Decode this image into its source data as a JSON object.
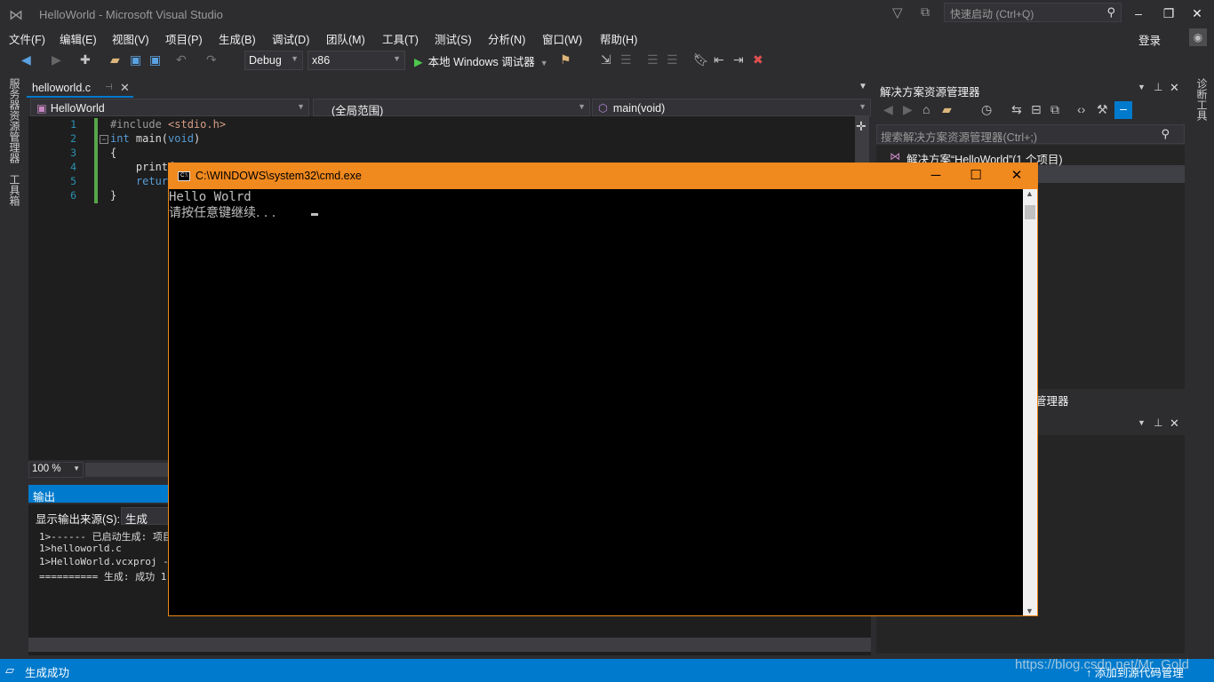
{
  "window": {
    "title": "HelloWorld - Microsoft Visual Studio",
    "quick_launch_placeholder": "快速启动 (Ctrl+Q)",
    "login": "登录"
  },
  "menu": [
    "文件(F)",
    "编辑(E)",
    "视图(V)",
    "项目(P)",
    "生成(B)",
    "调试(D)",
    "团队(M)",
    "工具(T)",
    "测试(S)",
    "分析(N)",
    "窗口(W)",
    "帮助(H)"
  ],
  "toolbar": {
    "config": "Debug",
    "platform": "x86",
    "run_label": "本地 Windows 调试器"
  },
  "left_strip": {
    "server_explorer": "服务器资源管理器",
    "toolbox": "工具箱"
  },
  "editor": {
    "tab_name": "helloworld.c",
    "nav_project": "HelloWorld",
    "nav_scope": "(全局范围)",
    "nav_member": "main(void)",
    "zoom": "100 %",
    "line_numbers": [
      "1",
      "2",
      "3",
      "4",
      "5",
      "6"
    ]
  },
  "output": {
    "title": "输出",
    "source_label": "显示输出来源(S):",
    "source_value": "生成",
    "lines": [
      "1>------ 已启动生成: 项目",
      "1>helloworld.c",
      "1>HelloWorld.vcxproj ->",
      "========== 生成: 成功 1"
    ]
  },
  "solution_explorer": {
    "title": "解决方案资源管理器",
    "search_placeholder": "搜索解决方案资源管理器(Ctrl+;)",
    "root": "解决方案“HelloWorld”(1 个项目)",
    "bottom_tab_fragment": "管理器"
  },
  "right_strip": {
    "diagnostic_tools": "诊断工具"
  },
  "statusbar": {
    "text": "生成成功",
    "right": "添加到源代码管理"
  },
  "watermark": "https://blog.csdn.net/Mr_Gold",
  "cmd": {
    "title": "C:\\WINDOWS\\system32\\cmd.exe",
    "icon_text": "C:\\",
    "line1": "Hello Wolrd",
    "line2": "请按任意键继续. . . "
  },
  "colors": {
    "accent": "#007acc",
    "cmd_titlebar": "#f0891e",
    "run_green": "#4ec94e"
  }
}
